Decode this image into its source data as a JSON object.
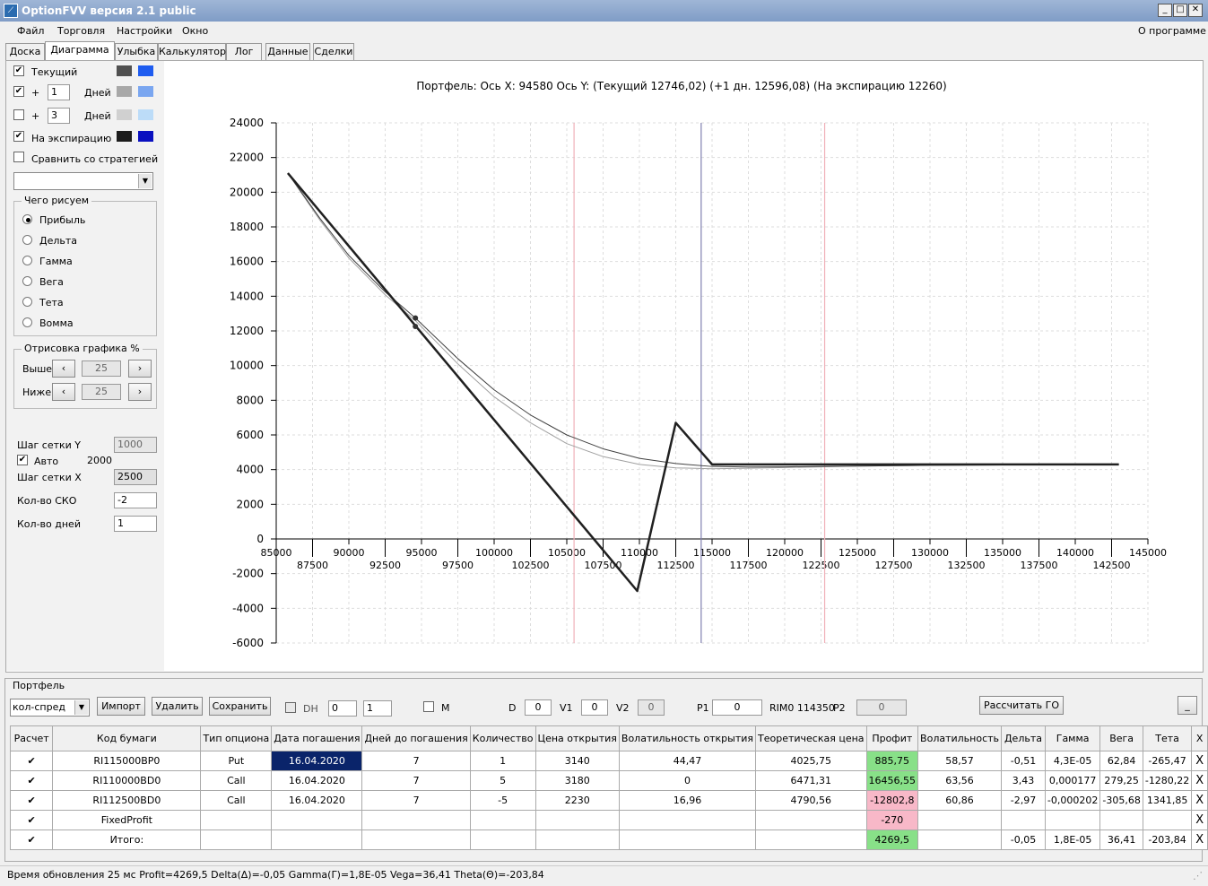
{
  "window": {
    "title": "OptionFVV версия 2.1 public",
    "icon": "app-icon"
  },
  "menu": {
    "items": [
      "Файл",
      "Торговля",
      "Настройки",
      "Окно"
    ],
    "about": "О программе"
  },
  "tabs": [
    "Доска",
    "Диаграмма",
    "Улыбка",
    "Калькулятор",
    "Лог",
    "Данные",
    "Сделки"
  ],
  "left": {
    "current": "Текущий",
    "plus": "+",
    "days1": "1",
    "days_label": "Дней",
    "days2": "3",
    "expiration": "На экспирацию",
    "compare": "Сравнить со стратегией",
    "draw_group": "Чего рисуем",
    "radios": [
      "Прибыль",
      "Дельта",
      "Гамма",
      "Вега",
      "Тета",
      "Вомма"
    ],
    "draw_pct_group": "Отрисовка графика %",
    "above": "Выше",
    "below": "Ниже",
    "above_val": "25",
    "below_val": "25",
    "grid_step_y": "Шаг сетки Y",
    "grid_y_val": "1000",
    "auto": "Авто",
    "auto_val": "2000",
    "grid_step_x": "Шаг сетки X",
    "grid_x_val": "2500",
    "sko": "Кол-во СКО",
    "sko_val": "-2",
    "days_count": "Кол-во дней",
    "days_count_val": "1",
    "colors": {
      "current": [
        "#505050",
        "#1e5cf0"
      ],
      "plus1": [
        "#a8a8a8",
        "#7aa6f0"
      ],
      "plus3": [
        "#d0d0d0",
        "#bcdcf8"
      ],
      "expiry": [
        "#1c1c1c",
        "#0a10c0"
      ]
    }
  },
  "chart_title": "Портфель: Ось X: 94580 Ось Y:  (Текущий 12746,02)  (+1 дн. 12596,08)  (На экспирацию 12260)",
  "chart_data": {
    "type": "line",
    "xlim": [
      85000,
      145000
    ],
    "ylim": [
      -6000,
      24000
    ],
    "x_ticks": [
      85000,
      87500,
      90000,
      92500,
      95000,
      97500,
      100000,
      102500,
      105000,
      107500,
      110000,
      112500,
      115000,
      117500,
      120000,
      122500,
      125000,
      127500,
      130000,
      132500,
      135000,
      137500,
      140000,
      142500,
      145000
    ],
    "y_ticks": [
      -6000,
      -4000,
      -2000,
      0,
      2000,
      4000,
      6000,
      8000,
      10000,
      12000,
      14000,
      16000,
      18000,
      20000,
      22000,
      24000
    ],
    "vlines": [
      {
        "x": 105500,
        "color": "#f0b0b8"
      },
      {
        "x": 114250,
        "color": "#8080b0"
      },
      {
        "x": 122750,
        "color": "#f0b0b8"
      }
    ],
    "series": [
      {
        "color": "#202020",
        "width": 2.5,
        "x": [
          85800,
          109850,
          112500,
          115000,
          143000
        ],
        "y": [
          21100,
          -3000,
          6700,
          4300,
          4300
        ]
      },
      {
        "color": "#404040",
        "width": 1,
        "x": [
          85800,
          88000,
          90000,
          92500,
          94580,
          97500,
          100000,
          102500,
          105000,
          107500,
          110000,
          112500,
          115000,
          117500,
          120000,
          125000,
          130000,
          143000
        ],
        "y": [
          21100,
          18500,
          16350,
          14250,
          12746,
          10400,
          8600,
          7150,
          6000,
          5200,
          4650,
          4350,
          4180,
          4150,
          4160,
          4200,
          4250,
          4300
        ]
      },
      {
        "color": "#a0a0a0",
        "width": 1,
        "x": [
          85800,
          88000,
          90000,
          92500,
          94580,
          97500,
          100000,
          102500,
          105000,
          107500,
          110000,
          112500,
          115000,
          117500,
          120000,
          125000,
          130000,
          143000
        ],
        "y": [
          21100,
          18400,
          16200,
          14080,
          12596,
          10100,
          8200,
          6700,
          5500,
          4750,
          4300,
          4100,
          4050,
          4080,
          4120,
          4200,
          4250,
          4300
        ]
      }
    ],
    "markers": [
      {
        "x": 94580,
        "y": 12746
      },
      {
        "x": 94580,
        "y": 12260
      }
    ]
  },
  "portfolio": {
    "title": "Портфель",
    "strategy": "кол-спред",
    "import": "Импорт",
    "delete": "Удалить",
    "save": "Сохранить",
    "dh": "DH",
    "dh_val1": "0",
    "dh_val2": "1",
    "m": "M",
    "d": "D",
    "d_val": "0",
    "v1": "V1",
    "v1_val": "0",
    "v2": "V2",
    "v2_val": "0",
    "p1": "P1",
    "p1_val": "0",
    "rim": "RIM0 114350",
    "p2": "P2",
    "p2_val": "0",
    "calc_go": "Рассчитать ГО",
    "minimize": "_"
  },
  "table": {
    "headers": [
      "Расчет",
      "Код бумаги",
      "Тип опциона",
      "Дата погашения",
      "Дней до погашения",
      "Количество",
      "Цена открытия",
      "Волатильность открытия",
      "Теоретическая цена",
      "Профит",
      "Волатильность",
      "Дельта",
      "Гамма",
      "Вега",
      "Тета",
      "X"
    ],
    "rows": [
      {
        "check": "✔",
        "code": "RI115000BP0",
        "type": "Put",
        "date": "16.04.2020",
        "days": "7",
        "qty": "1",
        "price": "3140",
        "vol_open": "44,47",
        "theo": "4025,75",
        "profit": "885,75",
        "vol": "58,57",
        "delta": "-0,51",
        "gamma": "4,3E-05",
        "vega": "62,84",
        "theta": "-265,47",
        "x": "X",
        "profit_class": "green",
        "date_sel": true
      },
      {
        "check": "✔",
        "code": "RI110000BD0",
        "type": "Call",
        "date": "16.04.2020",
        "days": "7",
        "qty": "5",
        "price": "3180",
        "vol_open": "0",
        "theo": "6471,31",
        "profit": "16456,55",
        "vol": "63,56",
        "delta": "3,43",
        "gamma": "0,000177",
        "vega": "279,25",
        "theta": "-1280,22",
        "x": "X",
        "profit_class": "green",
        "date_sel": false
      },
      {
        "check": "✔",
        "code": "RI112500BD0",
        "type": "Call",
        "date": "16.04.2020",
        "days": "7",
        "qty": "-5",
        "price": "2230",
        "vol_open": "16,96",
        "theo": "4790,56",
        "profit": "-12802,8",
        "vol": "60,86",
        "delta": "-2,97",
        "gamma": "-0,000202",
        "vega": "-305,68",
        "theta": "1341,85",
        "x": "X",
        "profit_class": "pink",
        "date_sel": false
      },
      {
        "check": "✔",
        "code": "FixedProfit",
        "type": "",
        "date": "",
        "days": "",
        "qty": "",
        "price": "",
        "vol_open": "",
        "theo": "",
        "profit": "-270",
        "vol": "",
        "delta": "",
        "gamma": "",
        "vega": "",
        "theta": "",
        "x": "X",
        "profit_class": "pink",
        "date_sel": false
      },
      {
        "check": "✔",
        "code": "Итого:",
        "type": "",
        "date": "",
        "days": "",
        "qty": "",
        "price": "",
        "vol_open": "",
        "theo": "",
        "profit": "4269,5",
        "vol": "",
        "delta": "-0,05",
        "gamma": "1,8E-05",
        "vega": "36,41",
        "theta": "-203,84",
        "x": "X",
        "profit_class": "green",
        "date_sel": false
      }
    ]
  },
  "status": "Время обновления 25 мс  Profit=4269,5 Delta(Δ)=-0,05 Gamma(Γ)=1,8E-05 Vega=36,41 Theta(Θ)=-203,84"
}
